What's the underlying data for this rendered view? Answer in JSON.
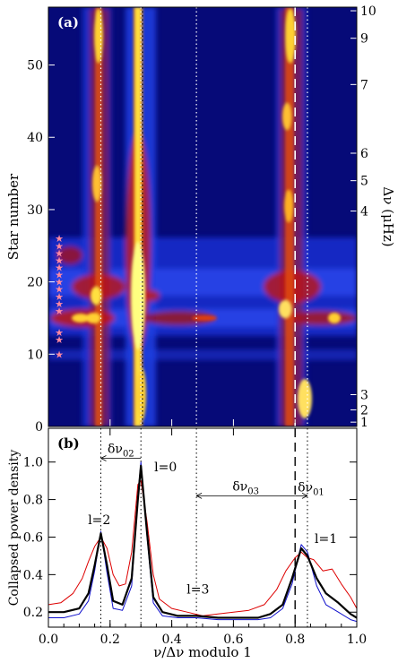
{
  "chart_data": [
    {
      "type": "heatmap",
      "panel_label": "(a)",
      "ylabel_left": "Star number",
      "ylabel_right": "Δν (μHz)",
      "xlim": [
        0.0,
        1.0
      ],
      "ylim": [
        0,
        58
      ],
      "yticks_left": [
        0,
        10,
        20,
        30,
        40,
        50
      ],
      "yticks_right": [
        {
          "label": "1",
          "star": 0.6
        },
        {
          "label": "2",
          "star": 2.3
        },
        {
          "label": "3",
          "star": 4.4
        },
        {
          "label": "4",
          "star": 29.8
        },
        {
          "label": "5",
          "star": 34.0
        },
        {
          "label": "6",
          "star": 37.8
        },
        {
          "label": "7",
          "star": 47.3
        },
        {
          "label": "9",
          "star": 53.7
        },
        {
          "label": "10",
          "star": 57.5
        }
      ],
      "star_markers_y": [
        10,
        12,
        13,
        16,
        17,
        18,
        19,
        20,
        21,
        22,
        23,
        24,
        25,
        26
      ],
      "dotted_lines_x": [
        0.17,
        0.3,
        0.48,
        0.84
      ],
      "dashed_lines_x": [
        0.8
      ],
      "ridges": [
        {
          "degree": "l=0",
          "x_start": 0.305,
          "x_end": 0.305
        },
        {
          "degree": "l=2",
          "x_start": 0.17,
          "x_end": 0.175
        },
        {
          "degree": "l=1",
          "x_start": 0.845,
          "x_end": 0.82
        }
      ]
    },
    {
      "type": "line",
      "panel_label": "(b)",
      "xlabel": "ν/Δν modulo 1",
      "ylabel": "Collapsed power density",
      "xlim": [
        0.0,
        1.0
      ],
      "ylim": [
        0.12,
        1.18
      ],
      "xticks": [
        "0.0",
        "0.2",
        "0.4",
        "0.6",
        "0.8",
        "1.0"
      ],
      "yticks": [
        "0.2",
        "0.4",
        "0.6",
        "0.8",
        "1.0"
      ],
      "series": [
        {
          "color": "#000000",
          "width": 2.2,
          "x": [
            0.0,
            0.05,
            0.1,
            0.13,
            0.15,
            0.17,
            0.19,
            0.21,
            0.24,
            0.27,
            0.29,
            0.3,
            0.32,
            0.34,
            0.37,
            0.42,
            0.48,
            0.55,
            0.62,
            0.68,
            0.72,
            0.76,
            0.79,
            0.82,
            0.84,
            0.87,
            0.9,
            0.94,
            0.98,
            1.0
          ],
          "y": [
            0.2,
            0.2,
            0.22,
            0.3,
            0.45,
            0.62,
            0.45,
            0.26,
            0.24,
            0.38,
            0.8,
            0.98,
            0.62,
            0.28,
            0.2,
            0.18,
            0.18,
            0.17,
            0.17,
            0.17,
            0.19,
            0.24,
            0.38,
            0.54,
            0.5,
            0.38,
            0.3,
            0.25,
            0.19,
            0.17
          ]
        },
        {
          "color": "#1010cc",
          "width": 1.0,
          "x": [
            0.0,
            0.05,
            0.1,
            0.13,
            0.15,
            0.17,
            0.19,
            0.21,
            0.24,
            0.27,
            0.29,
            0.3,
            0.32,
            0.34,
            0.37,
            0.42,
            0.48,
            0.55,
            0.62,
            0.68,
            0.72,
            0.76,
            0.79,
            0.82,
            0.84,
            0.87,
            0.9,
            0.94,
            0.98,
            1.0
          ],
          "y": [
            0.17,
            0.17,
            0.19,
            0.26,
            0.42,
            0.63,
            0.41,
            0.22,
            0.21,
            0.34,
            0.82,
            1.0,
            0.6,
            0.25,
            0.18,
            0.17,
            0.17,
            0.16,
            0.16,
            0.16,
            0.17,
            0.22,
            0.35,
            0.56,
            0.52,
            0.34,
            0.24,
            0.2,
            0.16,
            0.15
          ]
        },
        {
          "color": "#dd0000",
          "width": 1.0,
          "x": [
            0.0,
            0.04,
            0.08,
            0.11,
            0.13,
            0.15,
            0.17,
            0.19,
            0.21,
            0.23,
            0.25,
            0.27,
            0.29,
            0.3,
            0.32,
            0.34,
            0.36,
            0.4,
            0.45,
            0.5,
            0.55,
            0.6,
            0.65,
            0.7,
            0.74,
            0.77,
            0.8,
            0.82,
            0.84,
            0.86,
            0.89,
            0.92,
            0.95,
            0.98,
            1.0
          ],
          "y": [
            0.24,
            0.25,
            0.3,
            0.38,
            0.47,
            0.55,
            0.6,
            0.54,
            0.4,
            0.34,
            0.35,
            0.52,
            0.88,
            0.9,
            0.68,
            0.4,
            0.27,
            0.22,
            0.2,
            0.18,
            0.19,
            0.2,
            0.21,
            0.24,
            0.32,
            0.42,
            0.49,
            0.52,
            0.49,
            0.48,
            0.42,
            0.43,
            0.35,
            0.28,
            0.22
          ]
        }
      ],
      "annotations": [
        {
          "text": "l=2",
          "x": 0.165,
          "y": 0.67
        },
        {
          "text": "l=0",
          "x": 0.38,
          "y": 0.95
        },
        {
          "text": "l=3",
          "x": 0.485,
          "y": 0.3
        },
        {
          "text": "l=1",
          "x": 0.9,
          "y": 0.57
        }
      ],
      "spacings": [
        {
          "symbol": "δν",
          "sub": "02",
          "from": 0.3,
          "to": 0.17,
          "y": 1.02
        },
        {
          "symbol": "δν",
          "sub": "03",
          "from": 0.8,
          "to": 0.48,
          "y": 0.82
        },
        {
          "symbol": "δν",
          "sub": "01",
          "from": 0.8,
          "to": 0.84,
          "y": 0.82
        }
      ],
      "dotted_lines_x": [
        0.17,
        0.3,
        0.48,
        0.84
      ],
      "dashed_lines_x": [
        0.8
      ]
    }
  ]
}
